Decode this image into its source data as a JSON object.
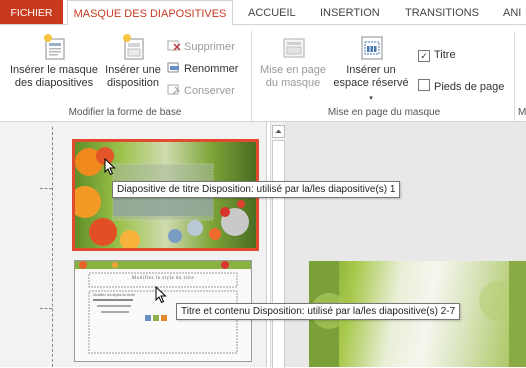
{
  "tabs": {
    "file": "FICHIER",
    "active": "MASQUE DES DIAPOSITIVES",
    "others": [
      "ACCUEIL",
      "INSERTION",
      "TRANSITIONS",
      "ANI"
    ]
  },
  "ribbon": {
    "group1": {
      "label": "Modifier la forme de base",
      "insert_master_line1": "Insérer le masque",
      "insert_master_line2": "des diapositives",
      "insert_layout_line1": "Insérer une",
      "insert_layout_line2": "disposition",
      "delete": "Supprimer",
      "rename": "Renommer",
      "preserve": "Conserver"
    },
    "group2": {
      "label": "Mise en page du masque",
      "master_layout_line1": "Mise en page",
      "master_layout_line2": "du masque",
      "insert_placeholder_line1": "Insérer un",
      "insert_placeholder_line2": "espace réservé",
      "title_checkbox": "Titre",
      "title_checked": true,
      "footers_checkbox": "Pieds de page",
      "footers_checked": false
    },
    "group3_partial_label": "M"
  },
  "thumbnails": {
    "slide1_tooltip": "Diapositive de titre Disposition: utilisé par la/les diapositive(s) 1",
    "slide2_tooltip": "Titre et contenu Disposition: utilisé par la/les diapositive(s) 2-7",
    "slide2_title_text": "Modifiez le style du titre",
    "slide2_bullet_text": "Modifiez les styles du texte"
  },
  "colors": {
    "accent": "#c8391e",
    "selection_border": "#e14a2e"
  }
}
